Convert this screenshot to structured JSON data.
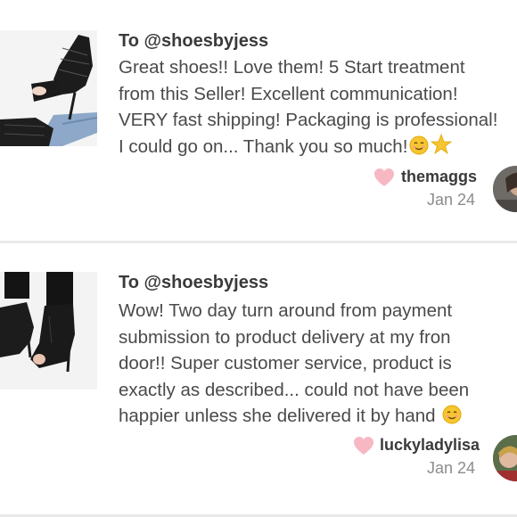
{
  "reviews": [
    {
      "to_line": "To @shoesbyjess",
      "body_lines": [
        "Great shoes!! Love them! 5 Start treatment",
        "from this Seller! Excellent communication!",
        "VERY fast shipping! Packaging is professional!",
        "I could go on... Thank you so much!"
      ],
      "emoji_names": [
        "smiling-face-icon",
        "star-icon"
      ],
      "username": "themaggs",
      "date": "Jan 24"
    },
    {
      "to_line": "To @shoesbyjess",
      "body_lines": [
        "Wow! Two day turn around from payment",
        "submission to product delivery at my fron",
        "door!! Super customer service, product is",
        "exactly as described... could not have been",
        "happier unless she delivered it by hand"
      ],
      "emoji_names": [
        "smiling-face-icon"
      ],
      "username": "luckyladylisa",
      "date": "Jan 24"
    }
  ],
  "colors": {
    "heart": "#f7b8c3",
    "text": "#4a4a4a",
    "muted": "#8c8c8c",
    "divider": "#e9e9e9"
  }
}
